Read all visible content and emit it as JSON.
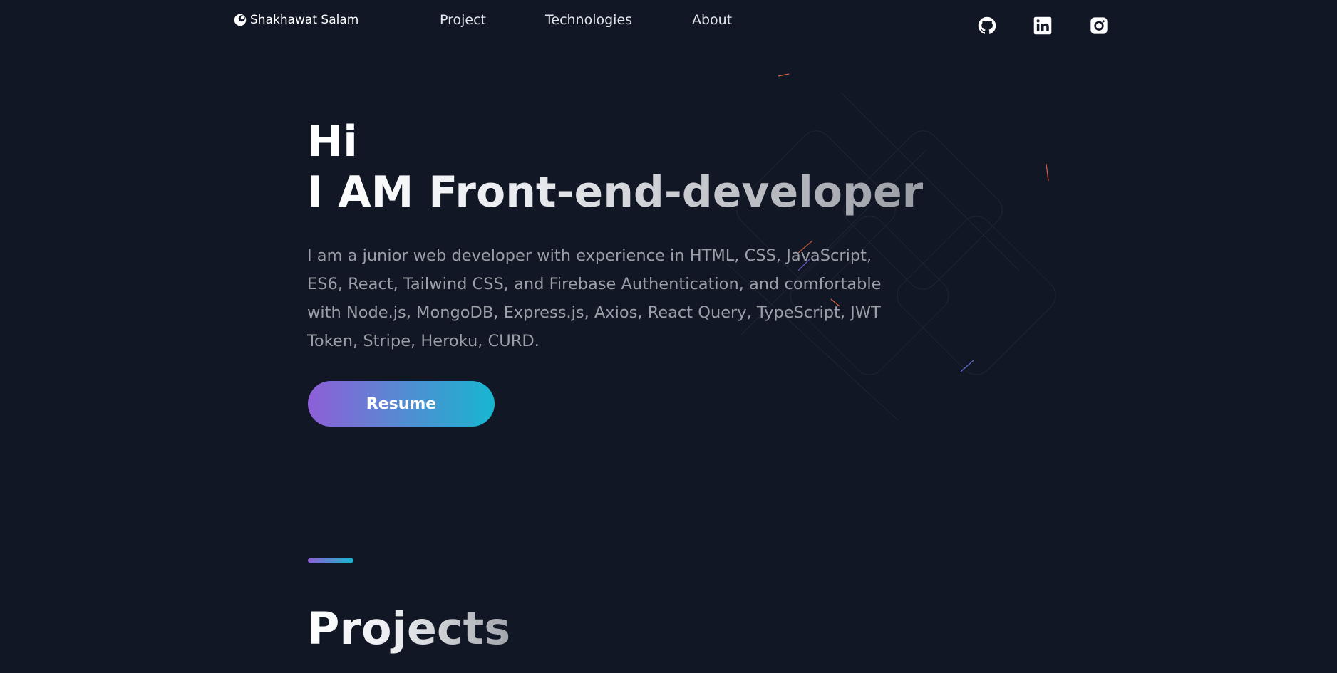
{
  "header": {
    "brand_name": "Shakhawat Salam",
    "brand_icon": "circle-swirl-logo-icon",
    "nav": [
      {
        "label": "Project"
      },
      {
        "label": "Technologies"
      },
      {
        "label": "About"
      }
    ],
    "social": [
      {
        "icon": "github-icon"
      },
      {
        "icon": "linkedin-icon"
      },
      {
        "icon": "instagram-icon"
      }
    ]
  },
  "hero": {
    "greeting": "Hi",
    "title": "I AM Front-end-developer",
    "description": "I am a junior web developer with experience in HTML, CSS, JavaScript, ES6, React, Tailwind CSS, and Firebase Authentication, and comfortable with Node.js, MongoDB, Express.js, Axios, React Query, TypeScript, JWT Token, Stripe, Heroku, CURD.",
    "resume_label": "Resume"
  },
  "projects": {
    "title": "Projects"
  },
  "colors": {
    "background": "#111724",
    "gradient_start": "#8e5fd8",
    "gradient_end": "#17b6d0",
    "text_primary": "#ffffff",
    "text_muted": "#9b9fa8"
  }
}
